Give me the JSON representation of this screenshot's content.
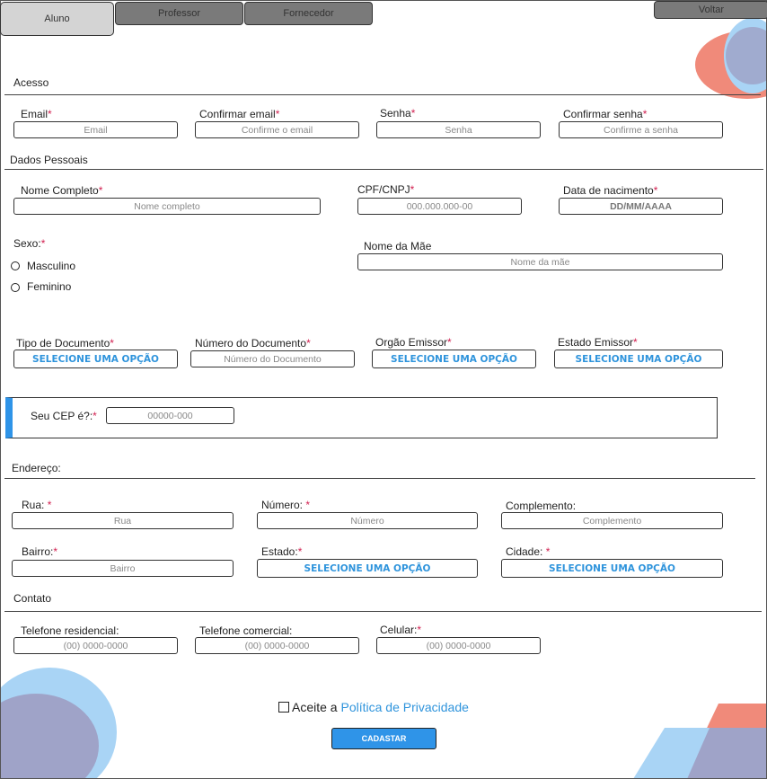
{
  "tabs": [
    {
      "label": "Aluno",
      "active": true
    },
    {
      "label": "Professor",
      "active": false
    },
    {
      "label": "Fornecedor",
      "active": false
    }
  ],
  "back_button": "Voltar",
  "sections": {
    "acesso": "Acesso",
    "dados_pessoais": "Dados Pessoais",
    "endereco": "Endereço:",
    "contato": "Contato"
  },
  "required_mark": "*",
  "fields": {
    "email": {
      "label": "Email",
      "placeholder": "Email"
    },
    "confirm_email": {
      "label": "Confirmar email",
      "placeholder": "Confirme o email"
    },
    "senha": {
      "label": "Senha",
      "placeholder": "Senha"
    },
    "confirm_senha": {
      "label": "Confirmar senha",
      "placeholder": "Confirme a senha"
    },
    "nome": {
      "label": "Nome Completo",
      "placeholder": "Nome completo"
    },
    "cpf": {
      "label": "CPF/CNPJ",
      "placeholder": "000.000.000-00"
    },
    "nascimento": {
      "label": "Data de nacimento",
      "placeholder": "DD/MM/AAAA"
    },
    "sexo": {
      "label": "Sexo:",
      "options": [
        "Masculino",
        "Feminino"
      ]
    },
    "mae": {
      "label": "Nome da Mãe",
      "placeholder": "Nome da mãe"
    },
    "tipo_doc": {
      "label": "Tipo de Documento",
      "value": "SELECIONE UMA OPÇÃO"
    },
    "num_doc": {
      "label": "Número do Documento",
      "placeholder": "Número do Documento"
    },
    "orgao": {
      "label": "Orgão Emissor",
      "value": "SELECIONE UMA OPÇÃO"
    },
    "estado_emissor": {
      "label": "Estado Emissor",
      "value": "SELECIONE UMA OPÇÃO"
    },
    "cep": {
      "label": "Seu CEP é?:",
      "placeholder": "00000-000"
    },
    "rua": {
      "label": "Rua: ",
      "placeholder": "Rua"
    },
    "numero": {
      "label": "Número: ",
      "placeholder": "Número"
    },
    "complemento": {
      "label": "Complemento:",
      "placeholder": "Complemento"
    },
    "bairro": {
      "label": "Bairro:",
      "placeholder": "Bairro"
    },
    "estado": {
      "label": "Estado:",
      "value": "SELECIONE UMA OPÇÃO"
    },
    "cidade": {
      "label": "Cidade: ",
      "value": "SELECIONE UMA OPÇÃO"
    },
    "tel_res": {
      "label": "Telefone residencial:",
      "placeholder": "(00) 0000-0000"
    },
    "tel_com": {
      "label": "Telefone comercial:",
      "placeholder": "(00) 0000-0000"
    },
    "celular": {
      "label": "Celular:",
      "placeholder": "(00) 0000-0000"
    }
  },
  "privacy": {
    "prefix": "Aceite a ",
    "link": "Política de Privacidade"
  },
  "submit": "CADASTAR",
  "colors": {
    "accent": "#2f94e8",
    "required": "#d11f4f",
    "coral": "#f08a7a",
    "light_blue": "#a9d4f5",
    "lavender": "#9fa3c8"
  }
}
